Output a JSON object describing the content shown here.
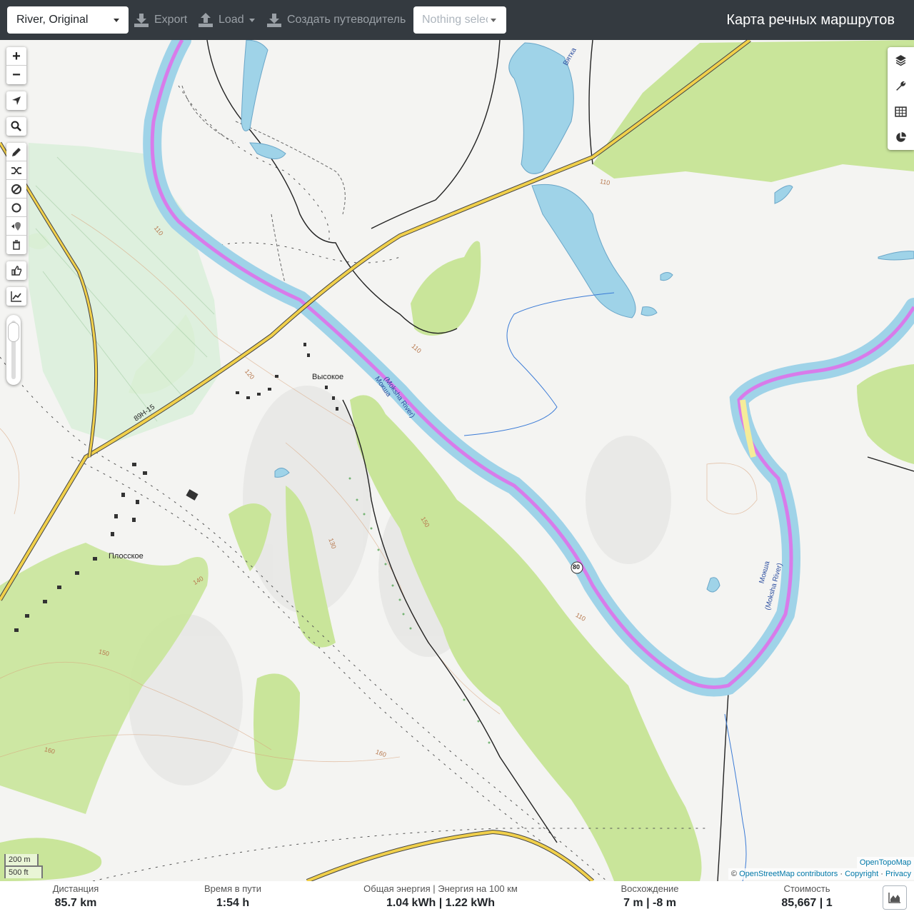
{
  "topbar": {
    "profile": "River, Original",
    "export_label": "Export",
    "load_label": "Load",
    "guide_label": "Создать путеводитель",
    "selection_placeholder": "Nothing selected",
    "app_title": "Карта речных маршрутов"
  },
  "map": {
    "zoom_in": "+",
    "zoom_out": "−",
    "labels": {
      "village_1": "Высокое",
      "village_2": "Плосское",
      "road_ref": "89Н-15",
      "river_1": "Мокша",
      "river_1_en": "(Moksha River)",
      "river_2": "Мокша",
      "river_2_en": "(Moksha River)",
      "lake": "Вятка",
      "road_shield": "80"
    },
    "contours": [
      "110",
      "110",
      "110",
      "120",
      "130",
      "140",
      "150",
      "150",
      "160",
      "160",
      "110"
    ],
    "scale_m": "200 m",
    "scale_ft": "500 ft",
    "attribution_top": "OpenTopoMap",
    "attribution_copy": "©",
    "attribution_osm": "OpenStreetMap contributors",
    "attribution_sep": "·",
    "attribution_copyright": "Copyright",
    "attribution_privacy": "Privacy"
  },
  "stats": {
    "distance_label": "Дистанция",
    "distance_value": "85.7 km",
    "time_label": "Время в пути",
    "time_value": "1:54 h",
    "energy_label": "Общая энергия | Энергия на 100 км",
    "energy_value": "1.04 kWh | 1.22 kWh",
    "ascent_label": "Восхождение",
    "ascent_value": "7 m | -8 m",
    "cost_label": "Стоимость",
    "cost_value": "85,667 | 1"
  },
  "colors": {
    "topbar": "#343a40",
    "river": "#9fd3e8",
    "route": "#d87bea",
    "forest": "#c9e59a",
    "road": "#f1d04b"
  }
}
